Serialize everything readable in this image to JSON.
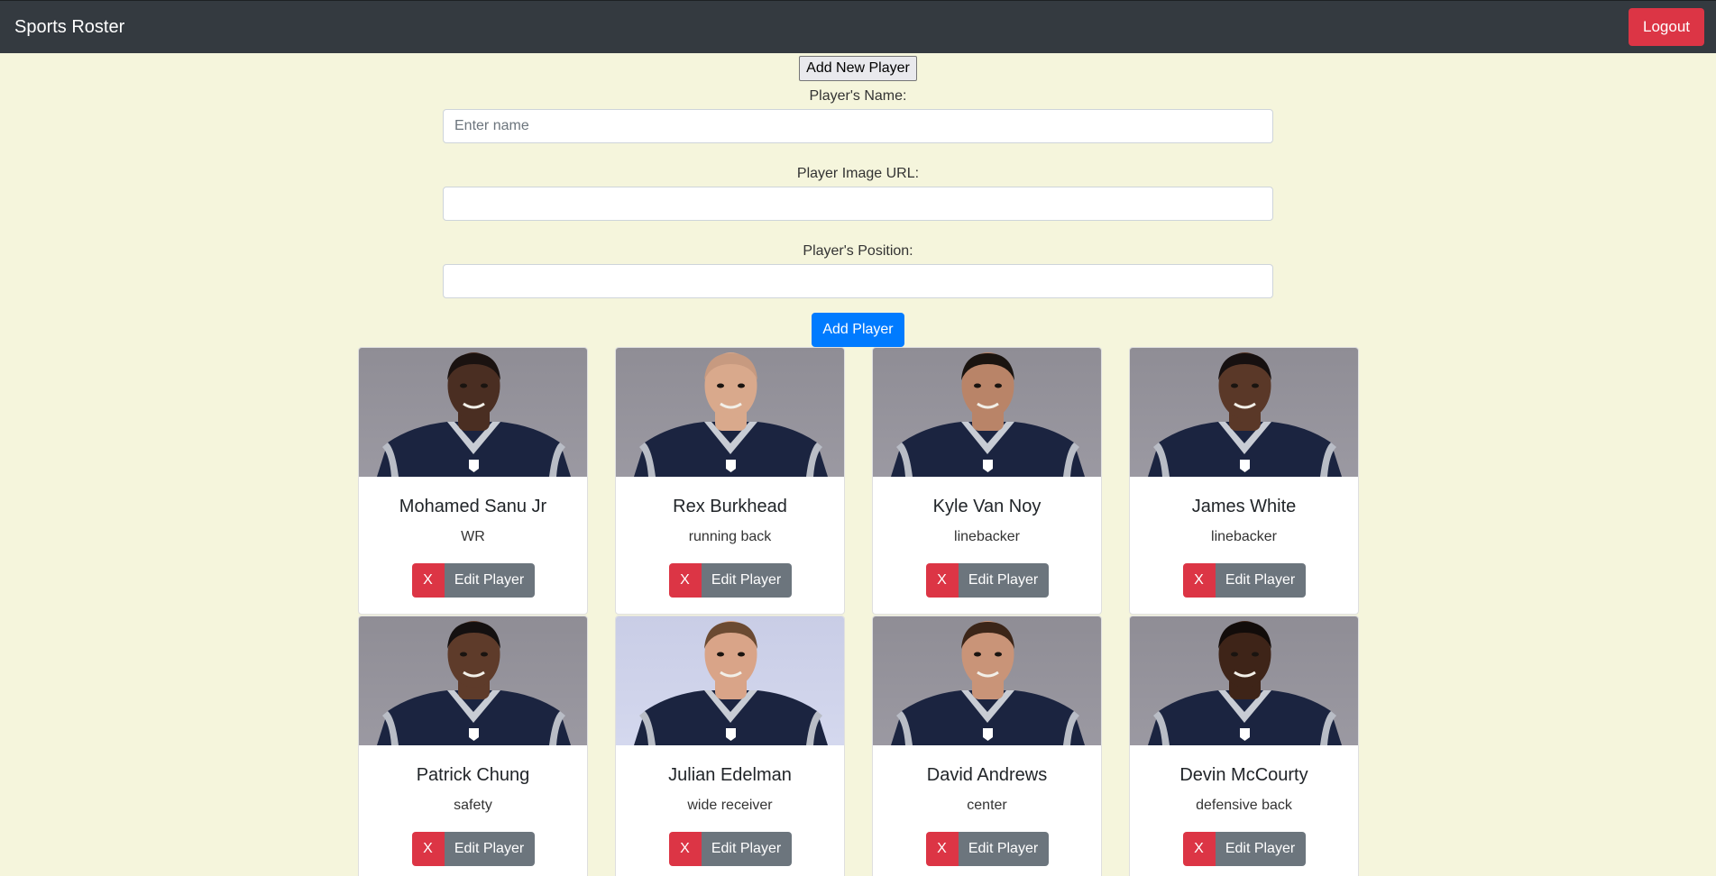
{
  "navbar": {
    "brand": "Sports Roster",
    "logout_label": "Logout"
  },
  "form": {
    "toggle_label": "Add New Player",
    "name_label": "Player's Name:",
    "name_placeholder": "Enter name",
    "name_value": "",
    "image_label": "Player Image URL:",
    "image_value": "",
    "position_label": "Player's Position:",
    "position_value": "",
    "submit_label": "Add Player"
  },
  "players": [
    {
      "name": "Mohamed Sanu Jr",
      "position": "WR",
      "skin": "#4a2e22",
      "hair": "#1a1210",
      "delete_label": "X",
      "edit_label": "Edit Player"
    },
    {
      "name": "Rex Burkhead",
      "position": "running back",
      "skin": "#d9a98c",
      "hair": "#c79a80",
      "delete_label": "X",
      "edit_label": "Edit Player"
    },
    {
      "name": "Kyle Van Noy",
      "position": "linebacker",
      "skin": "#b98468",
      "hair": "#1a1410",
      "delete_label": "X",
      "edit_label": "Edit Player"
    },
    {
      "name": "James White",
      "position": "linebacker",
      "skin": "#5a3828",
      "hair": "#161010",
      "delete_label": "X",
      "edit_label": "Edit Player"
    },
    {
      "name": "Patrick Chung",
      "position": "safety",
      "skin": "#5e3b2a",
      "hair": "#141010",
      "delete_label": "X",
      "edit_label": "Edit Player"
    },
    {
      "name": "Julian Edelman",
      "position": "wide receiver",
      "skin": "#d9a488",
      "hair": "#6b4a32",
      "delete_label": "X",
      "edit_label": "Edit Player"
    },
    {
      "name": "David Andrews",
      "position": "center",
      "skin": "#c99478",
      "hair": "#3b2518",
      "delete_label": "X",
      "edit_label": "Edit Player"
    },
    {
      "name": "Devin McCourty",
      "position": "defensive back",
      "skin": "#3e2418",
      "hair": "#120c0a",
      "delete_label": "X",
      "edit_label": "Edit Player"
    }
  ],
  "colors": {
    "page_bg": "#f5f5dc",
    "navbar_bg": "#343a40",
    "danger": "#dc3545",
    "primary": "#007bff",
    "secondary": "#6c757d",
    "jersey": "#1b2440"
  }
}
